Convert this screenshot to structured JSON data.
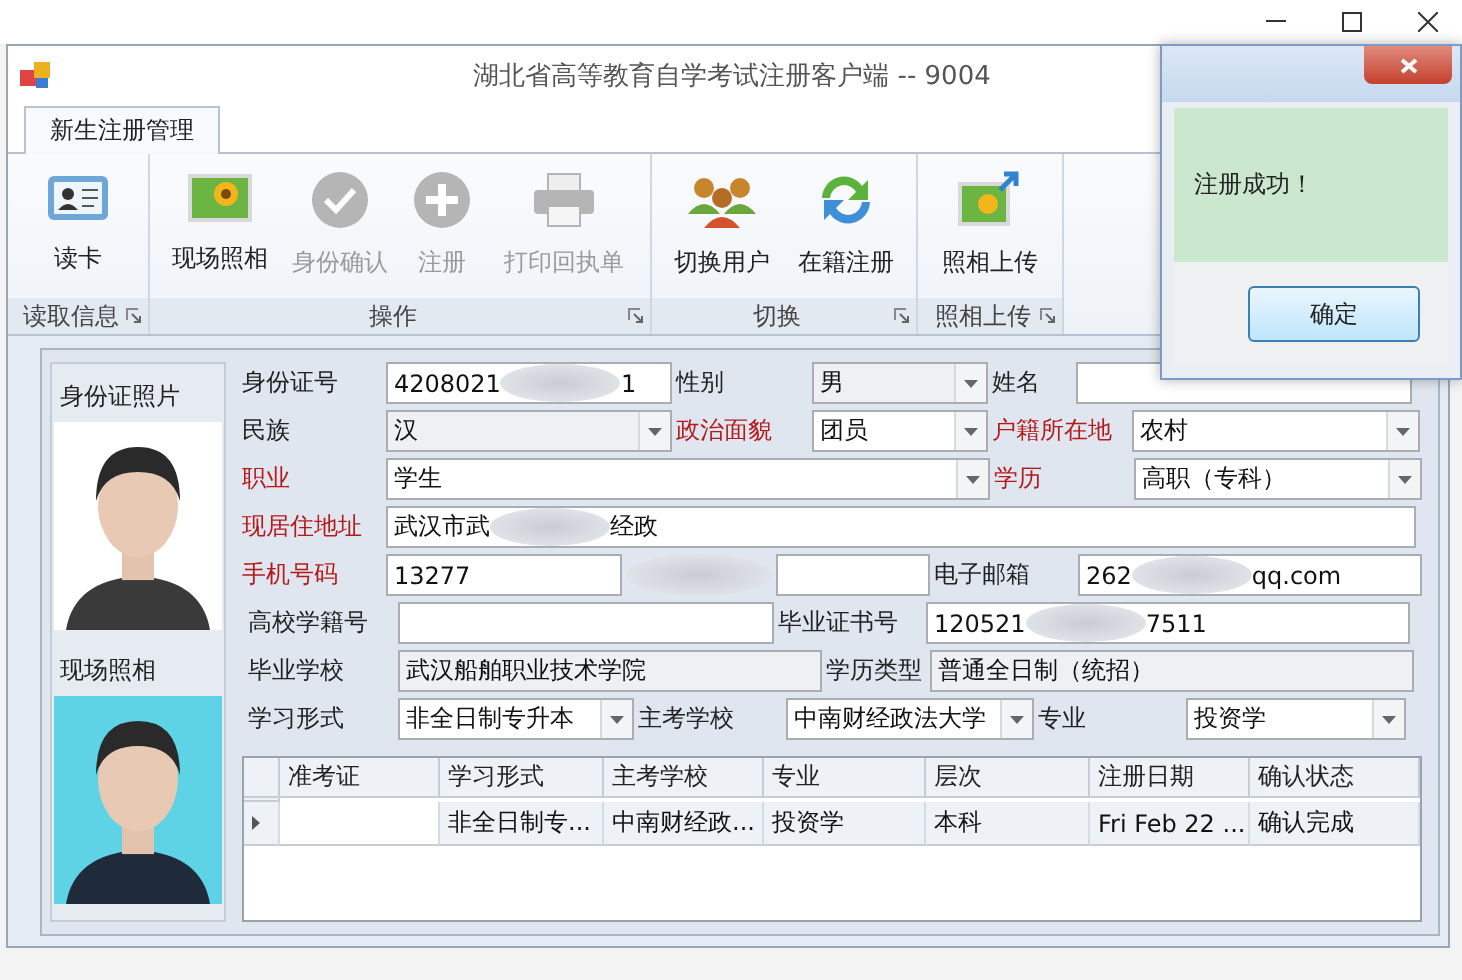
{
  "window": {
    "title": "湖北省高等教育自学考试注册客户端 -- 9004"
  },
  "ribbon": {
    "tabs": [
      {
        "label": "新生注册管理",
        "selected": true
      }
    ],
    "groups": [
      {
        "label": "读取信息",
        "buttons": [
          {
            "label": "读卡",
            "disabled": false
          }
        ]
      },
      {
        "label": "操作",
        "buttons": [
          {
            "label": "现场照相",
            "disabled": false
          },
          {
            "label": "身份确认",
            "disabled": true
          },
          {
            "label": "注册",
            "disabled": true
          },
          {
            "label": "打印回执单",
            "disabled": true
          }
        ]
      },
      {
        "label": "切换",
        "buttons": [
          {
            "label": "切换用户",
            "disabled": false
          },
          {
            "label": "在籍注册",
            "disabled": false
          }
        ]
      },
      {
        "label": "照相上传",
        "buttons": [
          {
            "label": "照相上传",
            "disabled": false
          }
        ]
      }
    ]
  },
  "photos": {
    "id_photo_label": "身份证照片",
    "scene_photo_label": "现场照相"
  },
  "form_rows": [
    [
      {
        "kind": "label",
        "text": "身份证号",
        "required": false
      },
      {
        "kind": "field",
        "value": "4208021",
        "value_tail": "1",
        "disabled": false
      },
      {
        "kind": "label",
        "text": "性别",
        "required": false
      },
      {
        "kind": "combo",
        "value": "男",
        "disabled": true
      },
      {
        "kind": "label",
        "text": "姓名",
        "required": false
      },
      {
        "kind": "field",
        "disabled": false
      }
    ],
    [
      {
        "kind": "label",
        "text": "民族",
        "required": false
      },
      {
        "kind": "combo",
        "value": "汉",
        "disabled": true
      },
      {
        "kind": "label",
        "text": "政治面貌",
        "required": true
      },
      {
        "kind": "combo",
        "value": "团员",
        "disabled": false
      },
      {
        "kind": "label",
        "text": "户籍所在地",
        "required": true
      },
      {
        "kind": "combo",
        "value": "农村",
        "disabled": false
      }
    ],
    [
      {
        "kind": "label",
        "text": "职业",
        "required": true
      },
      {
        "kind": "combo",
        "value": "学生",
        "disabled": false
      },
      {
        "kind": "label",
        "text": "学历",
        "required": true
      },
      {
        "kind": "combo",
        "value": "高职（专科）",
        "disabled": false
      }
    ],
    [
      {
        "kind": "label",
        "text": "现居住地址",
        "required": true
      },
      {
        "kind": "field",
        "value": "武汉市武",
        "value_tail": "经政",
        "disabled": false
      }
    ],
    [
      {
        "kind": "label",
        "text": "手机号码",
        "required": true
      },
      {
        "kind": "field",
        "value": "13277",
        "disabled": false
      },
      {
        "kind": "blur"
      },
      {
        "kind": "field",
        "disabled": false
      },
      {
        "kind": "label",
        "text": "电子邮箱",
        "required": false
      },
      {
        "kind": "field",
        "value": "262",
        "value_tail": "qq.com",
        "disabled": false
      }
    ],
    [
      {
        "kind": "label",
        "text": "高校学籍号",
        "required": false
      },
      {
        "kind": "field",
        "disabled": false
      },
      {
        "kind": "label",
        "text": "毕业证书号",
        "required": false
      },
      {
        "kind": "field",
        "value": "120521",
        "value_tail": "7511",
        "disabled": false
      }
    ],
    [
      {
        "kind": "label",
        "text": "毕业学校",
        "required": false
      },
      {
        "kind": "field",
        "value": "武汉船舶职业技术学院",
        "disabled": true
      },
      {
        "kind": "label",
        "text": "学历类型",
        "required": false
      },
      {
        "kind": "field",
        "value": "普通全日制（统招）",
        "disabled": true
      }
    ],
    [
      {
        "kind": "label",
        "text": "学习形式",
        "required": false
      },
      {
        "kind": "combo",
        "value": "非全日制专升本",
        "disabled": false
      },
      {
        "kind": "label",
        "text": "主考学校",
        "required": false
      },
      {
        "kind": "combo",
        "value": "中南财经政法大学",
        "disabled": false
      },
      {
        "kind": "label",
        "text": "专业",
        "required": false
      },
      {
        "kind": "combo",
        "value": "投资学",
        "disabled": false
      }
    ]
  ],
  "grid": {
    "columns": [
      "准考证",
      "学习形式",
      "主考学校",
      "专业",
      "层次",
      "注册日期",
      "确认状态"
    ],
    "rows": [
      {
        "current": true,
        "cells": [
          "",
          "非全日制专...",
          "中南财经政...",
          "投资学",
          "本科",
          "Fri Feb 22 ...",
          "确认完成"
        ]
      }
    ]
  },
  "dialog": {
    "message": "注册成功！",
    "button": "确定"
  }
}
